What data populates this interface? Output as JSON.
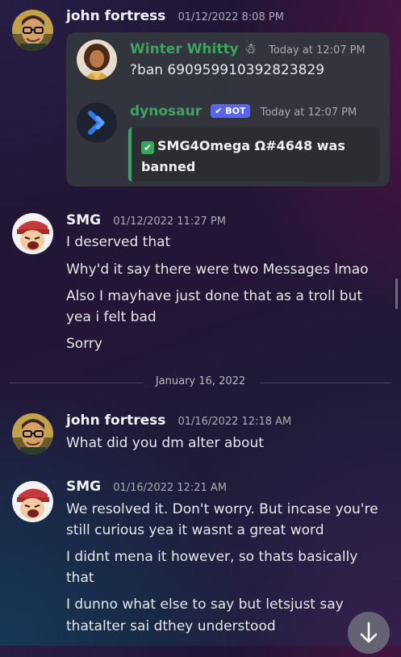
{
  "messages": [
    {
      "author": "john fortress",
      "timestamp": "01/12/2022 8:08 PM",
      "avatar_icon": "cartoon-man-with-glasses-avatar",
      "embedded": {
        "command": {
          "author": "Winter Whitty",
          "author_color": "#3ba55d",
          "badge_icon": "snowman-emoji",
          "timestamp": "Today at 12:07 PM",
          "text": "?ban 690959910392823829"
        },
        "bot_reply": {
          "author": "dynosaur",
          "author_color": "#3ba55d",
          "bot_badge": "BOT",
          "timestamp": "Today at 12:07 PM",
          "embed_line1": "SMG4Omega Ω#4648 was",
          "embed_line2": "banned"
        }
      }
    },
    {
      "author": "SMG",
      "timestamp": "01/12/2022 11:27 PM",
      "avatar_icon": "laughing-cartoon-avatar",
      "lines": [
        "I deserved that",
        "Why'd it say there were two Messages lmao",
        "Also I mayhave just done that as a troll but",
        "yea i felt bad",
        "Sorry"
      ]
    },
    {
      "date_divider": "January 16, 2022"
    },
    {
      "author": "john fortress",
      "timestamp": "01/16/2022 12:18 AM",
      "avatar_icon": "cartoon-man-with-glasses-avatar",
      "lines": [
        "What did you dm alter about"
      ]
    },
    {
      "author": "SMG",
      "timestamp": "01/16/2022 12:21 AM",
      "avatar_icon": "laughing-cartoon-avatar",
      "lines": [
        "We resolved it. Don't worry. But incase you're",
        "still curious yea it wasnt a great word",
        "I didnt mena it however, so thats basically",
        "that",
        "I dunno what else to say but letsjust say",
        "thatalter sai dthey understood"
      ]
    }
  ],
  "scroll_button_icon": "arrow-down-icon",
  "colors": {
    "accent_green": "#3ba55d",
    "bot_badge": "#5865f2",
    "embed_bar": "#3ba55d"
  }
}
